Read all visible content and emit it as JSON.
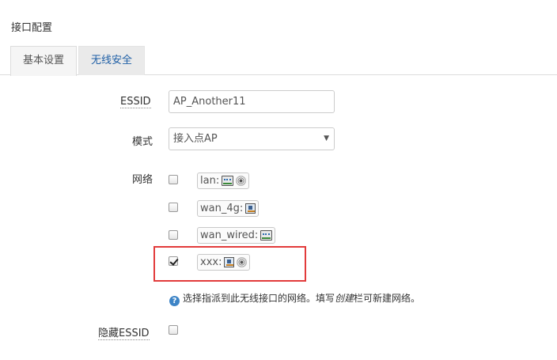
{
  "section": {
    "title": "接口配置"
  },
  "tabs": [
    {
      "label": "基本设置",
      "active": true
    },
    {
      "label": "无线安全",
      "active": false
    }
  ],
  "form": {
    "essid": {
      "label": "ESSID",
      "value": "AP_Another11"
    },
    "mode": {
      "label": "模式",
      "selected": "接入点AP"
    },
    "network": {
      "label": "网络",
      "options": [
        {
          "name": "lan:",
          "checked": false,
          "icons": [
            "switch-icon",
            "wireless-icon"
          ]
        },
        {
          "name": "wan_4g:",
          "checked": false,
          "icons": [
            "ethernet-icon"
          ]
        },
        {
          "name": "wan_wired:",
          "checked": false,
          "icons": [
            "switch-icon"
          ]
        },
        {
          "name": "xxx:",
          "checked": true,
          "icons": [
            "ethernet-icon",
            "wireless-icon"
          ]
        }
      ],
      "help": {
        "before": "选择指派到此无线接口的网络。填写",
        "emphasis": "创建",
        "after": "栏可新建网络。"
      }
    },
    "hide_essid": {
      "label": "隐藏ESSID",
      "checked": false
    }
  },
  "colors": {
    "highlight": "#e23b3b",
    "tab_link": "#1f5fa6",
    "help_icon": "#3d84c6"
  }
}
